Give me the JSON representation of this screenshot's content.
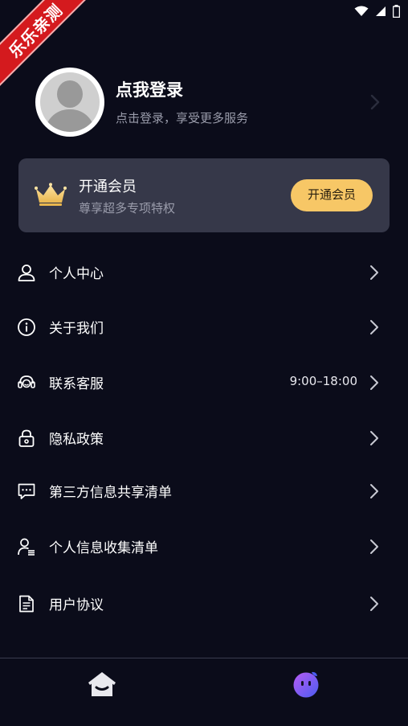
{
  "status": {
    "icons": [
      "wifi-icon",
      "signal-icon",
      "battery-icon"
    ]
  },
  "watermark": {
    "text": "乐乐亲测"
  },
  "profile": {
    "title": "点我登录",
    "subtitle": "点击登录，享受更多服务"
  },
  "vip": {
    "title": "开通会员",
    "subtitle": "尊享超多专项特权",
    "button_label": "开通会员"
  },
  "menu": {
    "items": [
      {
        "label": "个人中心",
        "icon": "user-icon",
        "value": ""
      },
      {
        "label": "关于我们",
        "icon": "info-icon",
        "value": ""
      },
      {
        "label": "联系客服",
        "icon": "headset-icon",
        "value": "9:00–18:00"
      },
      {
        "label": "隐私政策",
        "icon": "lock-icon",
        "value": ""
      },
      {
        "label": "第三方信息共享清单",
        "icon": "message-icon",
        "value": ""
      },
      {
        "label": "个人信息收集清单",
        "icon": "user-list-icon",
        "value": ""
      },
      {
        "label": "用户协议",
        "icon": "document-icon",
        "value": ""
      }
    ]
  },
  "nav": {
    "items": [
      {
        "icon": "home-icon",
        "active": false
      },
      {
        "icon": "profile-face-icon",
        "active": true
      }
    ]
  },
  "colors": {
    "background": "#0b0c1a",
    "card": "#363849",
    "accent_gold": "#f7c766",
    "ribbon_red": "#d41a1e",
    "nav_active": "#5a5cf0"
  }
}
